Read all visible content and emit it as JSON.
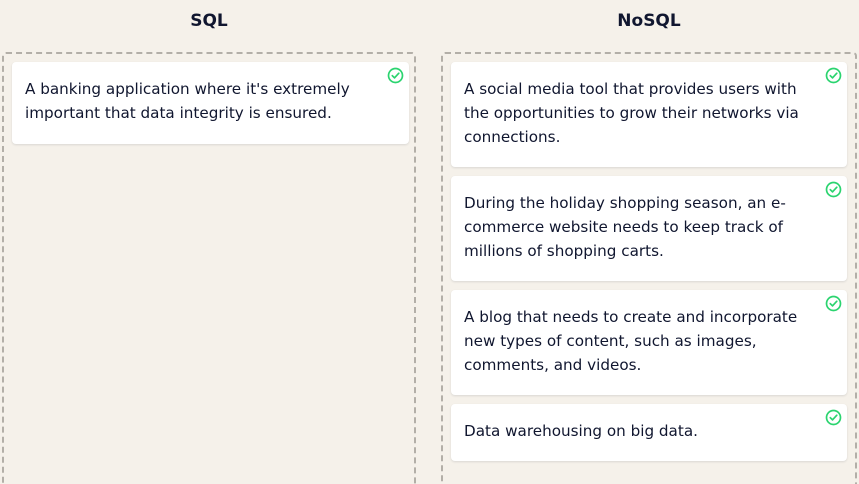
{
  "columns": [
    {
      "title": "SQL",
      "cards": [
        {
          "text": "A banking application where it's extremely important that data integrity is ensured.",
          "status_icon": "check-circle-icon"
        }
      ]
    },
    {
      "title": "NoSQL",
      "cards": [
        {
          "text": "A social media tool that provides users with the opportunities to grow their networks via connections.",
          "status_icon": "check-circle-icon"
        },
        {
          "text": "During the holiday shopping season, an e-commerce website needs to keep track of millions of shopping carts.",
          "status_icon": "check-circle-icon"
        },
        {
          "text": "A blog that needs to create and incorporate new types of content, such as images, comments, and videos.",
          "status_icon": "check-circle-icon"
        },
        {
          "text": "Data warehousing on big data.",
          "status_icon": "check-circle-icon"
        }
      ]
    }
  ],
  "colors": {
    "background": "#f5f1ea",
    "card": "#ffffff",
    "correct": "#2bd46f",
    "text": "#10162f",
    "dashed_border": "#b3afa8"
  }
}
